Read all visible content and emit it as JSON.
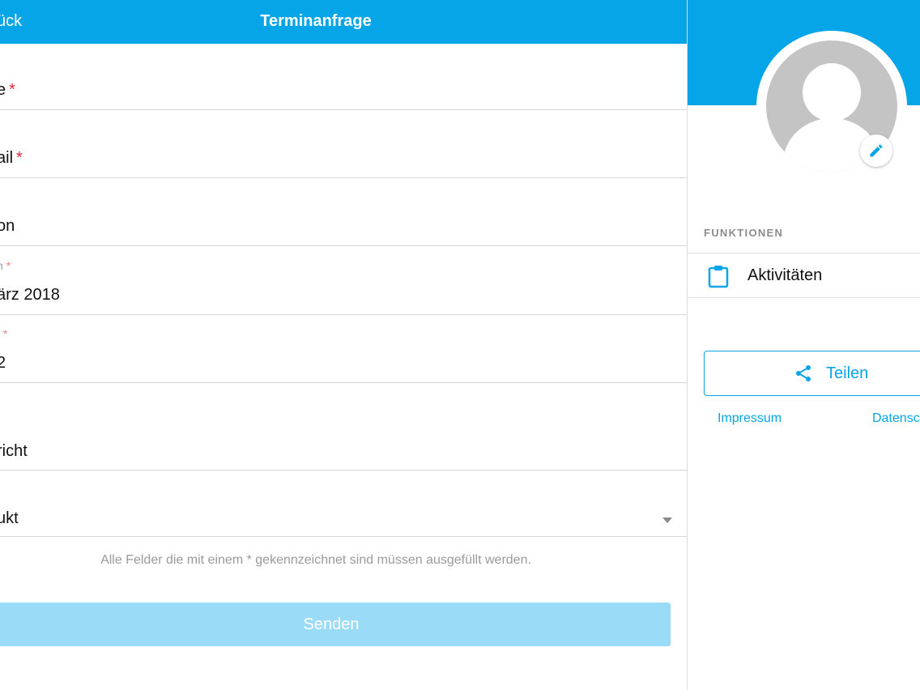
{
  "header": {
    "back_label": "ück",
    "title": "Terminanfrage"
  },
  "form": {
    "fields": [
      {
        "value": "e",
        "required": "*"
      },
      {
        "value": "ail",
        "required": "*"
      },
      {
        "value": "on"
      },
      {
        "label": "n",
        "label_required": "*",
        "value": "ärz 2018"
      },
      {
        "label": "t",
        "label_required": "*",
        "value": "2"
      },
      {
        "value": "richt"
      },
      {
        "value": "ukt"
      }
    ],
    "hint": "Alle Felder die mit einem * gekennzeichnet sind müssen ausgefüllt werden.",
    "submit_label": "Senden"
  },
  "profile": {
    "section_title": "FUNKTIONEN",
    "menu": [
      {
        "label": "Aktivitäten",
        "icon": "clipboard-icon"
      }
    ],
    "share_label": "Teilen",
    "links": [
      "Impressum",
      "Datensc"
    ]
  },
  "colors": {
    "primary": "#06a5e8",
    "required": "#e0243a",
    "disabled_button": "#9adcf7"
  }
}
